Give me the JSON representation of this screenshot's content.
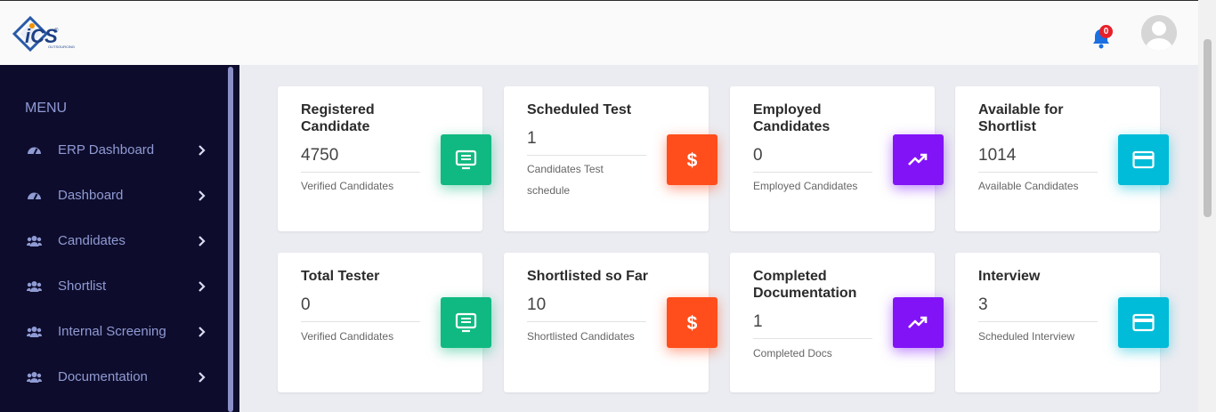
{
  "header": {
    "logo_text": "iCS",
    "logo_subtext": "OUTSOURCING",
    "notification_count": "0"
  },
  "sidebar": {
    "menu_title": "MENU",
    "items": [
      {
        "label": "ERP Dashboard",
        "icon": "dashboard-icon"
      },
      {
        "label": "Dashboard",
        "icon": "dashboard-icon"
      },
      {
        "label": "Candidates",
        "icon": "users-icon"
      },
      {
        "label": "Shortlist",
        "icon": "users-icon"
      },
      {
        "label": "Internal Screening",
        "icon": "users-icon"
      },
      {
        "label": "Documentation",
        "icon": "users-icon"
      }
    ]
  },
  "cards": [
    {
      "title": "Registered Candidate",
      "value": "4750",
      "subtitle": "Verified Candidates",
      "icon": "monitor-icon",
      "color": "#10b981"
    },
    {
      "title": "Scheduled Test",
      "value": "1",
      "subtitle": "Candidates Test schedule",
      "icon": "dollar-icon",
      "color": "#ff4e1b"
    },
    {
      "title": "Employed Candidates",
      "value": "0",
      "subtitle": "Employed Candidates",
      "icon": "trending-up-icon",
      "color": "#8213f7"
    },
    {
      "title": "Available for Shortlist",
      "value": "1014",
      "subtitle": "Available Candidates",
      "icon": "credit-card-icon",
      "color": "#00bcd8"
    },
    {
      "title": "Total Tester",
      "value": "0",
      "subtitle": "Verified Candidates",
      "icon": "monitor-icon",
      "color": "#10b981"
    },
    {
      "title": "Shortlisted so Far",
      "value": "10",
      "subtitle": "Shortlisted Candidates",
      "icon": "dollar-icon",
      "color": "#ff4e1b"
    },
    {
      "title": "Completed Documentation",
      "value": "1",
      "subtitle": "Completed Docs",
      "icon": "trending-up-icon",
      "color": "#8213f7"
    },
    {
      "title": "Interview",
      "value": "3",
      "subtitle": "Scheduled Interview",
      "icon": "credit-card-icon",
      "color": "#00bcd8"
    }
  ]
}
